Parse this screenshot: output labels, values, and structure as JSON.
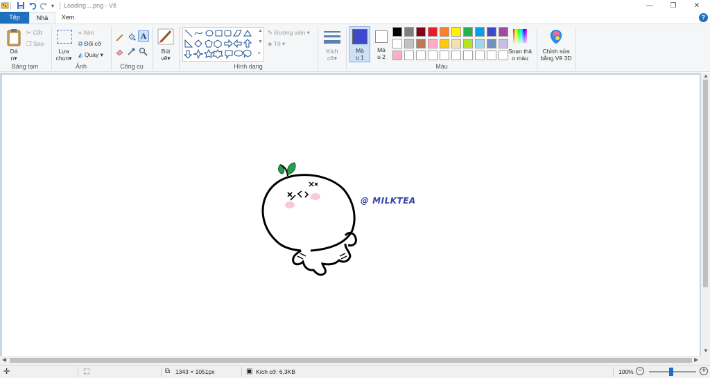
{
  "window": {
    "title": "Loading....png - Vẽ",
    "minimize": "—",
    "restore": "❐",
    "close": "✕"
  },
  "tabs": {
    "file": "Tệp",
    "home": "Nhà",
    "view": "Xem",
    "help": "?"
  },
  "clipboard": {
    "paste_line1": "Dá",
    "paste_line2": "n",
    "cut": "Cắt",
    "copy": "Sao",
    "group": "Bảng tạm"
  },
  "image": {
    "select_line1": "Lựa",
    "select_line2": "chọn",
    "crop": "Xén",
    "resize": "Đổi cỡ",
    "rotate": "Quay",
    "group": "Ảnh"
  },
  "tools": {
    "group": "Công cụ"
  },
  "brushes": {
    "line1": "Bút",
    "line2": "vẽ"
  },
  "shapes": {
    "outline": "Đường viền",
    "fill": "Tô",
    "group": "Hình dạng"
  },
  "size": {
    "line1": "Kích",
    "line2": "cỡ"
  },
  "colors": {
    "color1_line1": "Mà",
    "color1_line2": "u 1",
    "color2_line1": "Mà",
    "color2_line2": "u 2",
    "edit_line1": "Soạn thả",
    "edit_line2": "o màu",
    "group": "Màu",
    "color1_value": "#3f48cc",
    "color2_value": "#ffffff",
    "palette_row1": [
      "#000000",
      "#7f7f7f",
      "#880015",
      "#ed1c24",
      "#ff7f27",
      "#fff200",
      "#22b14c",
      "#00a2e8",
      "#3f48cc",
      "#a349a4"
    ],
    "palette_row2": [
      "#ffffff",
      "#c3c3c3",
      "#b97a57",
      "#ffaec9",
      "#ffc90e",
      "#efe4b0",
      "#b5e61d",
      "#99d9ea",
      "#7092be",
      "#c8bfe7"
    ],
    "palette_row3": [
      "#ffaec9",
      "#ffffff",
      "#ffffff",
      "#ffffff",
      "#ffffff",
      "#ffffff",
      "#ffffff",
      "#ffffff",
      "#ffffff",
      "#ffffff"
    ]
  },
  "paint3d": {
    "line1": "Chỉnh sửa",
    "line2": "bằng Vẽ 3D"
  },
  "canvas": {
    "watermark": "@ MILKTEA"
  },
  "status": {
    "dimensions": "1343 × 1051px",
    "filesize": "Kích cỡ: 6,3KB",
    "zoom": "100%"
  }
}
